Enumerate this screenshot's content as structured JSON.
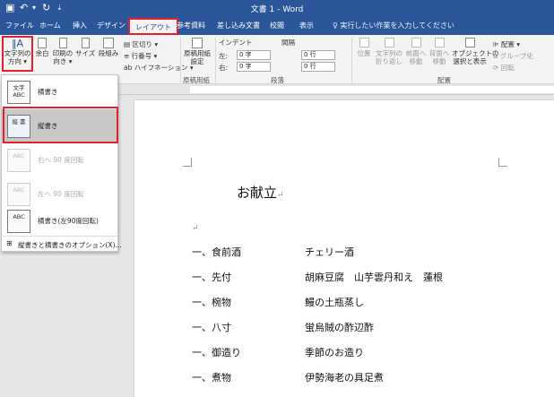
{
  "window": {
    "title": "文書 1  -  Word"
  },
  "tabs": [
    "ファイル",
    "ホーム",
    "挿入",
    "デザイン",
    "レイアウト",
    "参考資料",
    "差し込み文書",
    "校閲",
    "表示"
  ],
  "tell_me": "実行したい作業を入力してください",
  "ribbon": {
    "text_direction": [
      "文字列の",
      "方向 ▾"
    ],
    "margins": "余白",
    "orientation": [
      "印刷の",
      "向き ▾"
    ],
    "size": "サイズ",
    "columns": "段組み",
    "breaks": "区切り ▾",
    "line_numbers": "行番号 ▾",
    "hyphenation": "ハイフネーション ▾",
    "manuscript": [
      "原稿用紙",
      "設定"
    ],
    "manuscript_group": "原稿用紙",
    "indent_label": "インデント",
    "indent_left_label": "左:",
    "indent_left_value": "0 字",
    "indent_right_label": "右:",
    "indent_right_value": "0 字",
    "spacing_label": "間隔",
    "spacing_before_value": "0 行",
    "spacing_after_value": "0 行",
    "paragraph_group": "段落",
    "position": "位置",
    "wrap_text": [
      "文字列の",
      "折り返し"
    ],
    "bring_forward": [
      "前面へ",
      "移動"
    ],
    "send_backward": [
      "背面へ",
      "移動"
    ],
    "selection_pane": [
      "オブジェクトの",
      "選択と表示"
    ],
    "align": "配置 ▾",
    "group": "グループ化",
    "rotate": "回転",
    "arrange_group": "配置"
  },
  "dropdown": {
    "items": [
      {
        "icon": "文字 ABC",
        "label": "横書き"
      },
      {
        "icon": "縦 書",
        "label": "縦書き"
      },
      {
        "icon": "ABC",
        "label": "右へ 90 度回転"
      },
      {
        "icon": "ABC",
        "label": "左へ 90 度回転"
      },
      {
        "icon": "ABC",
        "label": "横書き(左90度回転)"
      }
    ],
    "options": "縦書きと横書きのオプション(X)..."
  },
  "document": {
    "title": "お献立",
    "rows": [
      {
        "course": "一、食前酒",
        "dish": "チェリー酒"
      },
      {
        "course": "一、先付",
        "dish": "胡麻豆腐　山芋雲丹和え　蓮根"
      },
      {
        "course": "一、椀物",
        "dish": "鰻の土瓶蒸し"
      },
      {
        "course": "一、八寸",
        "dish": "蛍烏賊の酢辺酢"
      },
      {
        "course": "一、御造り",
        "dish": "季節のお造り"
      },
      {
        "course": "一、煮物",
        "dish": "伊勢海老の具足煮"
      }
    ]
  }
}
